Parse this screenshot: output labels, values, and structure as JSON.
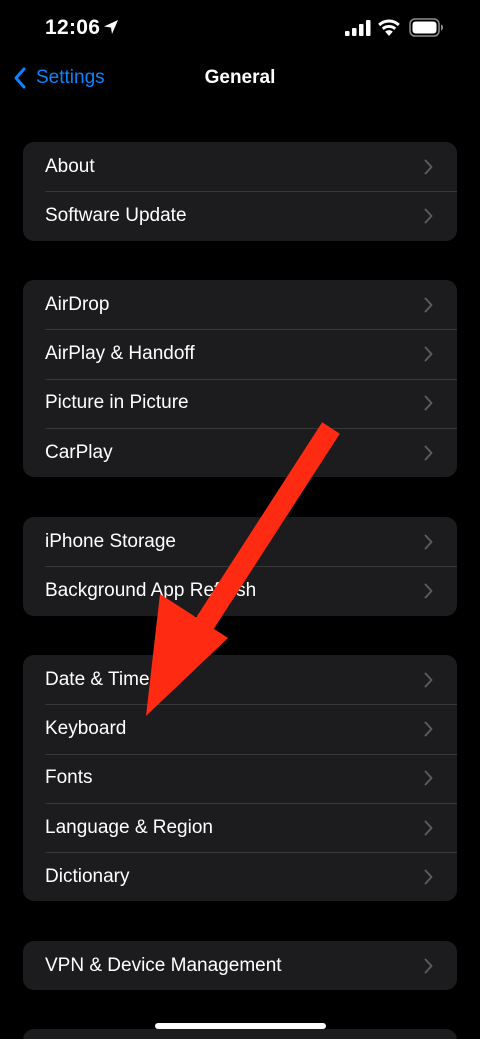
{
  "status_bar": {
    "time": "12:06",
    "icons": [
      "location-arrow-icon",
      "cellular-signal-icon",
      "wifi-icon",
      "battery-icon"
    ]
  },
  "nav": {
    "back_label": "Settings",
    "title": "General"
  },
  "groups": [
    {
      "items": [
        {
          "label": "About"
        },
        {
          "label": "Software Update"
        }
      ]
    },
    {
      "items": [
        {
          "label": "AirDrop"
        },
        {
          "label": "AirPlay & Handoff"
        },
        {
          "label": "Picture in Picture"
        },
        {
          "label": "CarPlay"
        }
      ]
    },
    {
      "items": [
        {
          "label": "iPhone Storage"
        },
        {
          "label": "Background App Refresh"
        }
      ]
    },
    {
      "items": [
        {
          "label": "Date & Time"
        },
        {
          "label": "Keyboard"
        },
        {
          "label": "Fonts"
        },
        {
          "label": "Language & Region"
        },
        {
          "label": "Dictionary"
        }
      ]
    },
    {
      "items": [
        {
          "label": "VPN & Device Management"
        }
      ]
    }
  ],
  "colors": {
    "background": "#000000",
    "cell": "#1c1c1e",
    "separator": "#38383a",
    "accent": "#0a84ff",
    "chevron": "#5a5a5e",
    "annotation_arrow": "#ff2a12"
  }
}
